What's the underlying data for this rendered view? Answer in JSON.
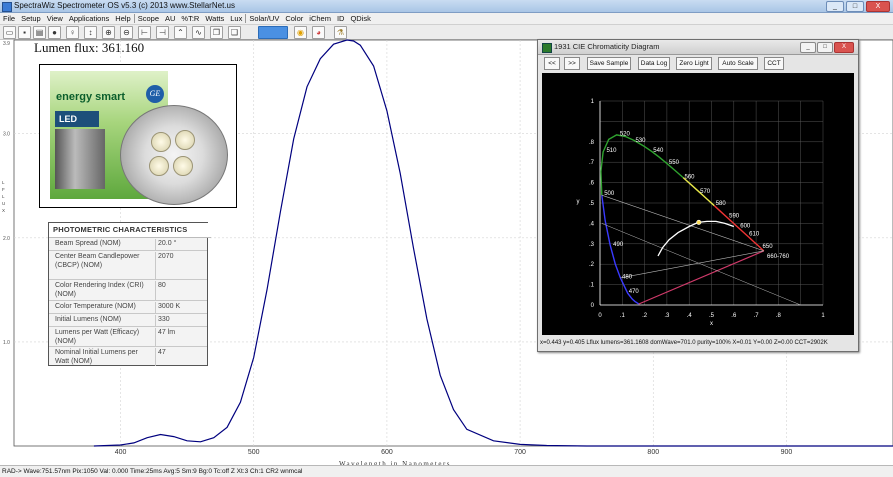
{
  "window": {
    "title": "SpectraWiz  Spectrometer OS v5.3 (c) 2013   www.StellarNet.us",
    "controls": [
      "_",
      "□",
      "X"
    ]
  },
  "menu": [
    "File",
    "Setup",
    "View",
    "Applications",
    "Help",
    "Scope",
    "AU",
    "%T:R",
    "Watts",
    "Lux",
    "Solar/UV",
    "Color",
    "iChem",
    "ID",
    "QDisk"
  ],
  "toolbar_icons": [
    "open-icon",
    "save-icon",
    "print-icon",
    "probe-icon",
    "lamp-icon",
    "scale-icon",
    "zoom-in-icon",
    "zoom-out-icon",
    "cursor-icon",
    "cursor-right-icon",
    "peak-icon",
    "overlay-icon",
    "copy-icon",
    "copy-data-icon",
    "bar-icon",
    "target-icon",
    "color-wheel-icon",
    "chem-icon"
  ],
  "spectrum": {
    "lumen_flux_label": "Lumen flux:",
    "lumen_flux_value": "361.160",
    "x_axis_label": "Wavelength in Nanometers",
    "y_axis_letters": [
      "L",
      "F",
      "L",
      "U",
      "X"
    ],
    "chart_data": {
      "type": "line",
      "xlabel": "Wavelength in Nanometers",
      "ylabel": "",
      "xlim": [
        320,
        980
      ],
      "ylim": [
        0,
        3.9
      ],
      "x_ticks": [
        400,
        500,
        600,
        700,
        800,
        900
      ],
      "y_ticks": [
        "1.0",
        "2.0",
        "3.0"
      ],
      "y_top_label": "3.9",
      "grid": true,
      "series": [
        {
          "color": "#00007f",
          "x": [
            380,
            400,
            410,
            420,
            430,
            440,
            450,
            460,
            470,
            480,
            490,
            500,
            510,
            520,
            530,
            540,
            550,
            560,
            570,
            575,
            580,
            590,
            600,
            610,
            620,
            630,
            640,
            650,
            660,
            680,
            700,
            720,
            750
          ],
          "y": [
            0.0,
            0.01,
            0.03,
            0.08,
            0.11,
            0.09,
            0.05,
            0.04,
            0.08,
            0.18,
            0.42,
            0.85,
            1.5,
            2.25,
            2.95,
            3.45,
            3.72,
            3.86,
            3.9,
            3.89,
            3.85,
            3.65,
            3.22,
            2.62,
            1.9,
            1.22,
            0.68,
            0.35,
            0.16,
            0.05,
            0.015,
            0.005,
            0.0
          ]
        }
      ]
    }
  },
  "photometric": {
    "title": "PHOTOMETRIC CHARACTERISTICS",
    "rows": [
      {
        "k": "Beam Spread (NOM)",
        "v": "20.0 °"
      },
      {
        "k": "Center Beam Candlepower (CBCP) (NOM)",
        "v": "2070"
      },
      {
        "k": "Color Rendering Index (CRI) (NOM)",
        "v": "80"
      },
      {
        "k": "Color Temperature (NOM)",
        "v": "3000 K"
      },
      {
        "k": "Initial Lumens (NOM)",
        "v": "330"
      },
      {
        "k": "Lumens per Watt (Efficacy) (NOM)",
        "v": "47 lm"
      },
      {
        "k": "Nominal Initial Lumens per Watt (NOM)",
        "v": "47"
      }
    ]
  },
  "product_photo": {
    "brand_text": "energy smart",
    "maker_text": "GE",
    "led_text": "LED"
  },
  "cie": {
    "title": "1931 CIE Chromaticity Diagram",
    "window_controls": [
      "_",
      "□",
      "X"
    ],
    "buttons": [
      "<<",
      ">>",
      "Save Sample",
      "Data Log",
      "Zero Light",
      "Auto Scale",
      "CCT"
    ],
    "status": "x=0.443 y=0.405  Lflux lumens=361.1608   domWave=701.0   purity=100%  X=0.01   Y=0.00  Z=0.00 CCT=2902K",
    "chart_data": {
      "type": "scatter",
      "xlim": [
        0,
        1
      ],
      "ylim": [
        0,
        1
      ],
      "x_ticks": [
        "0",
        ".1",
        ".2",
        ".3",
        ".4",
        ".5",
        ".6",
        ".7",
        ".8",
        "1"
      ],
      "y_ticks": [
        "0",
        ".1",
        ".2",
        ".3",
        ".4",
        ".5",
        ".6",
        ".7",
        ".8",
        "1"
      ],
      "x_axis_label": "x",
      "y_axis_label": "y",
      "grid": true,
      "locus_labels": [
        {
          "t": "470",
          "x": 0.12,
          "y": 0.06
        },
        {
          "t": "480",
          "x": 0.09,
          "y": 0.13
        },
        {
          "t": "490",
          "x": 0.05,
          "y": 0.29
        },
        {
          "t": "500",
          "x": 0.01,
          "y": 0.54
        },
        {
          "t": "510",
          "x": 0.02,
          "y": 0.75
        },
        {
          "t": "520",
          "x": 0.08,
          "y": 0.83
        },
        {
          "t": "530",
          "x": 0.15,
          "y": 0.8
        },
        {
          "t": "540",
          "x": 0.23,
          "y": 0.75
        },
        {
          "t": "550",
          "x": 0.3,
          "y": 0.69
        },
        {
          "t": "560",
          "x": 0.37,
          "y": 0.62
        },
        {
          "t": "570",
          "x": 0.44,
          "y": 0.55
        },
        {
          "t": "580",
          "x": 0.51,
          "y": 0.49
        },
        {
          "t": "590",
          "x": 0.57,
          "y": 0.43
        },
        {
          "t": "600",
          "x": 0.62,
          "y": 0.38
        },
        {
          "t": "610",
          "x": 0.66,
          "y": 0.34
        },
        {
          "t": "650",
          "x": 0.72,
          "y": 0.28
        },
        {
          "t": "660-760",
          "x": 0.74,
          "y": 0.23
        }
      ],
      "measured_point": {
        "x": 0.443,
        "y": 0.405
      }
    }
  },
  "statusbar": "RAD->  Wave:751.57nm  Pix:1050  Val:  0.000  Time:25ms  Avg:5  Sm:9  Bg:0  Tc:off  Z  Xt:3  Ch:1  CR2 wnmcal"
}
